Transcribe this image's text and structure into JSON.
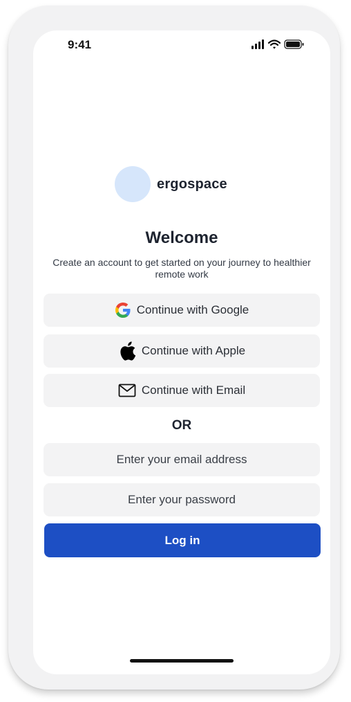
{
  "status_bar": {
    "time": "9:41",
    "icons": [
      "cellular-signal-icon",
      "wifi-icon",
      "battery-icon"
    ]
  },
  "brand": {
    "name": "ergospace",
    "logo_color": "#d6e6fb"
  },
  "header": {
    "title": "Welcome",
    "subtitle": "Create an account to get started on your journey to healthier remote work"
  },
  "auth_options": {
    "google_label": "Continue with Google",
    "apple_label": "Continue with Apple",
    "email_label": "Continue with Email"
  },
  "divider": {
    "label": "OR"
  },
  "form": {
    "email_placeholder": "Enter your email address",
    "email_value": "",
    "password_placeholder": "Enter your password",
    "password_value": "",
    "login_label": "Log in"
  },
  "colors": {
    "primary": "#1d4fc4",
    "button_bg": "#f3f3f4",
    "text": "#1e2430"
  }
}
